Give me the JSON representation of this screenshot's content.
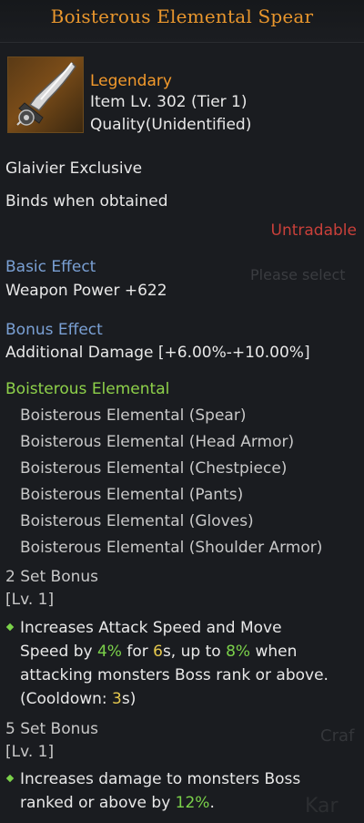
{
  "title": "Boisterous Elemental Spear",
  "item": {
    "rarity": "Legendary",
    "item_level": "Item Lv. 302 (Tier 1)",
    "quality": "Quality(Unidentified)",
    "class_exclusive": "Glaivier Exclusive",
    "binds": "Binds when obtained",
    "trade": "Untradable"
  },
  "basic_effect": {
    "heading": "Basic Effect",
    "value": "Weapon Power +622"
  },
  "bonus_effect": {
    "heading": "Bonus Effect",
    "value": "Additional Damage [+6.00%-+10.00%]"
  },
  "set": {
    "name": "Boisterous Elemental",
    "pieces": [
      "Boisterous Elemental (Spear)",
      "Boisterous Elemental (Head Armor)",
      "Boisterous Elemental (Chestpiece)",
      "Boisterous Elemental (Pants)",
      "Boisterous Elemental (Gloves)",
      "Boisterous Elemental (Shoulder Armor)"
    ],
    "bonus2": {
      "heading": "2 Set Bonus",
      "level": "[Lv. 1]",
      "line1_a": "Increases Attack Speed and Move",
      "line2_a": "Speed by ",
      "line2_v1": "4%",
      "line2_b": " for ",
      "line2_v2": "6",
      "line2_c": "s, up to ",
      "line2_v3": "8%",
      "line2_d": " when",
      "line3": "attacking monsters Boss rank or above.",
      "line4_a": "(Cooldown: ",
      "line4_v": "3",
      "line4_b": "s)"
    },
    "bonus5": {
      "heading": "5 Set Bonus",
      "level": "[Lv. 1]",
      "line1": "Increases damage to monsters Boss",
      "line2_a": "ranked or above by ",
      "line2_v": "12%",
      "line2_b": "."
    }
  },
  "background_fragments": [
    "Please select",
    "Craf",
    "Kar"
  ],
  "colors": {
    "title": "#e8962d",
    "legendary": "#f39a2c",
    "untradable": "#c9403a",
    "section_heading": "#7aa0d4",
    "set_name": "#8ed14a",
    "highlight_green": "#7bd24a",
    "highlight_yellow": "#e6c94e"
  }
}
